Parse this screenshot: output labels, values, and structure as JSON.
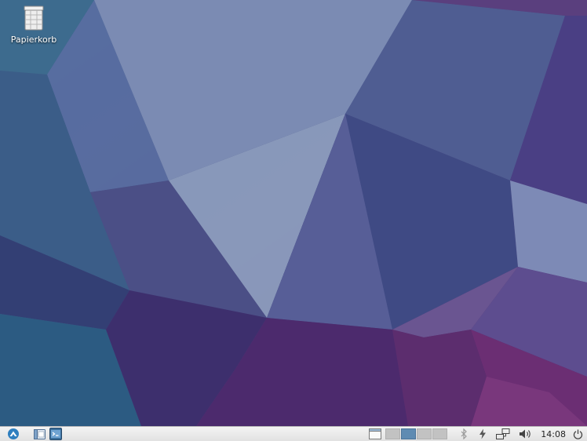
{
  "desktop": {
    "icons": [
      {
        "label": "Papierkorb",
        "icon": "trash-icon"
      }
    ]
  },
  "taskbar": {
    "menu_icon": "lubuntu-menu-icon",
    "launchers": [
      {
        "icon": "file-manager-icon"
      },
      {
        "icon": "terminal-icon"
      }
    ],
    "workspaces": {
      "count": 4,
      "active_index": 1
    },
    "tray": [
      {
        "icon": "bluetooth-icon"
      },
      {
        "icon": "power-manager-icon"
      },
      {
        "icon": "network-icon"
      },
      {
        "icon": "volume-icon"
      }
    ],
    "clock": "14:08",
    "shutdown_icon": "power-icon"
  }
}
